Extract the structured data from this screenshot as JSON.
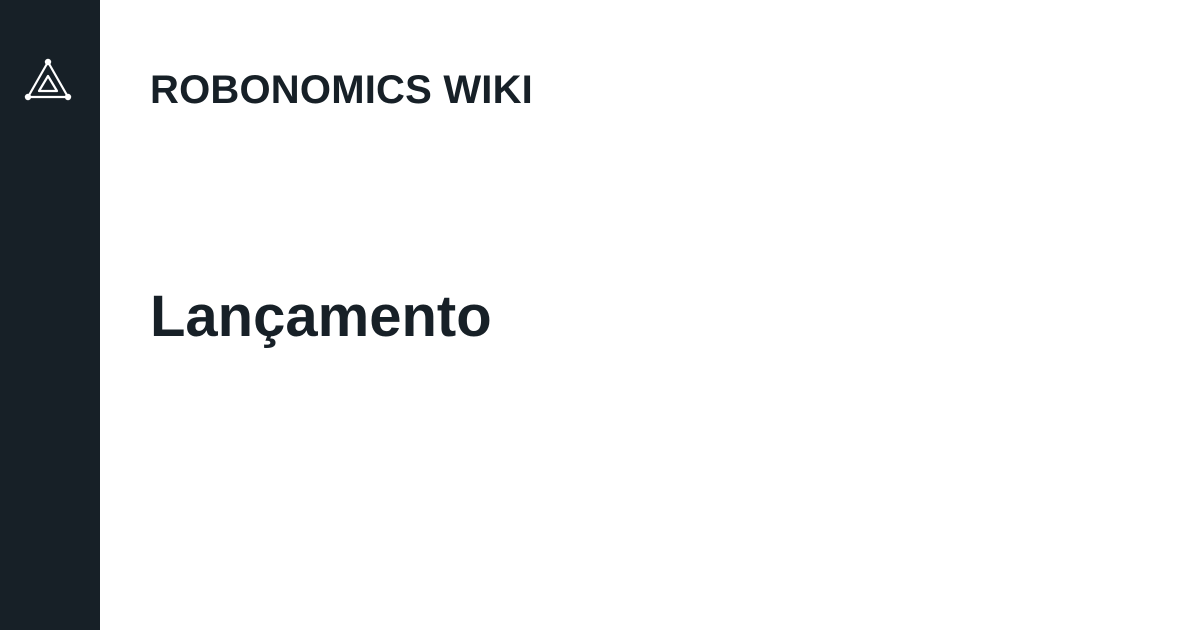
{
  "site": {
    "title": "ROBONOMICS WIKI",
    "logo_icon": "robonomics-triangle-logo-icon"
  },
  "page": {
    "title": "Lançamento"
  },
  "colors": {
    "sidebar_bg": "#172027",
    "page_bg": "#ffffff",
    "text": "#172027",
    "logo": "#ffffff"
  }
}
